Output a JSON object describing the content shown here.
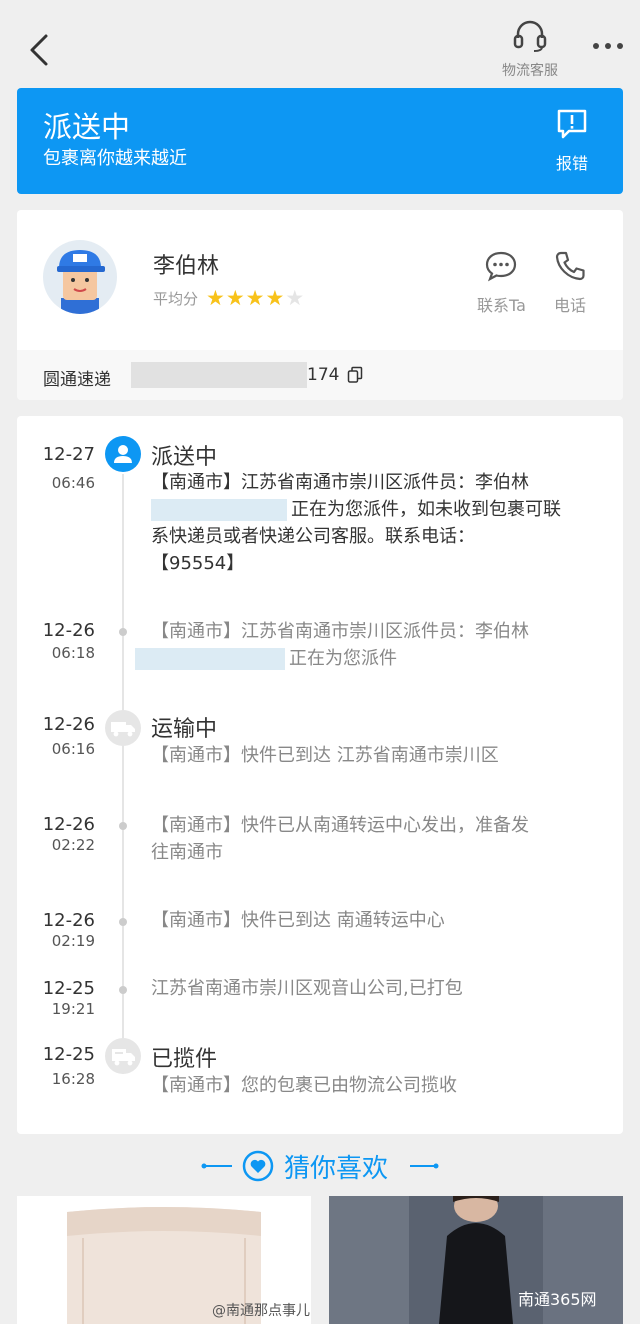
{
  "header": {
    "service_label": "物流客服"
  },
  "banner": {
    "title": "派送中",
    "subtitle": "包裹离你越来越近",
    "report_label": "报错"
  },
  "courier": {
    "name": "李伯林",
    "rating_label": "平均分",
    "rating": 4,
    "rating_max": 5,
    "contact_label": "联系Ta",
    "phone_label": "电话",
    "company": "圆通速递",
    "waybill_visible_suffix": "174"
  },
  "timeline": [
    {
      "date": "12-27",
      "time": "06:46",
      "title": "派送中",
      "icon": "person-icon",
      "active": true,
      "lines": [
        "【南通市】江苏省南通市崇川区派件员：李伯林",
        "正在为您派件，如未收到包裹可联",
        "系快递员或者快递公司客服。联系电话：",
        "【95554】"
      ]
    },
    {
      "date": "12-26",
      "time": "06:18",
      "title": "",
      "icon": "",
      "active": false,
      "lines": [
        "【南通市】江苏省南通市崇川区派件员：李伯林",
        "正在为您派件"
      ]
    },
    {
      "date": "12-26",
      "time": "06:16",
      "title": "运输中",
      "icon": "truck-icon",
      "active": false,
      "lines": [
        "【南通市】快件已到达 江苏省南通市崇川区"
      ]
    },
    {
      "date": "12-26",
      "time": "02:22",
      "title": "",
      "icon": "",
      "active": false,
      "lines": [
        "【南通市】快件已从南通转运中心发出，准备发",
        "往南通市"
      ]
    },
    {
      "date": "12-26",
      "time": "02:19",
      "title": "",
      "icon": "",
      "active": false,
      "lines": [
        "【南通市】快件已到达 南通转运中心"
      ]
    },
    {
      "date": "12-25",
      "time": "19:21",
      "title": "",
      "icon": "",
      "active": false,
      "lines": [
        "江苏省南通市崇川区观音山公司,已打包"
      ]
    },
    {
      "date": "12-25",
      "time": "16:28",
      "title": "已揽件",
      "icon": "package-truck-icon",
      "active": false,
      "lines": [
        "【南通市】您的包裹已由物流公司揽收"
      ]
    }
  ],
  "recommend": {
    "title": "猜你喜欢"
  },
  "watermarks": {
    "left": "@南通那点事儿",
    "right": "南通365网"
  },
  "colors": {
    "accent": "#0d97f3",
    "star": "#f8c21a",
    "background": "#efefef"
  }
}
